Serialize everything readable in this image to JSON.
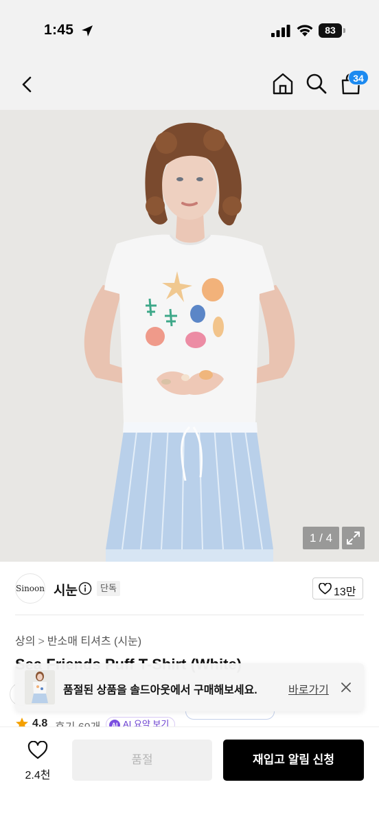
{
  "status_bar": {
    "time": "1:45",
    "battery": "83",
    "icons": [
      "location-arrow-icon",
      "signal-icon",
      "wifi-icon",
      "battery-icon"
    ]
  },
  "header": {
    "back_icon": "chevron-left-icon",
    "home_icon": "home-icon",
    "search_icon": "search-icon",
    "bag_icon": "shopping-bag-icon",
    "bag_count": "34",
    "badge_color": "#1c8af0"
  },
  "product_image": {
    "counter": "1 / 4",
    "expand_icon": "expand-icon"
  },
  "brand": {
    "logo_text": "Sinoon",
    "name": "시눈",
    "info_icon": "info-icon",
    "badge": "단독",
    "like_count": "13만"
  },
  "breadcrumb": {
    "items": [
      "상의",
      "반소매 티셔츠 (시눈)"
    ],
    "separator": ">"
  },
  "product": {
    "title_partial": "Sea Friends Puff T-Shirt (White)"
  },
  "rating": {
    "score": "4.8",
    "reviews": "후기 69개",
    "ai_label": "AI",
    "ai_text": "AI 요약 보기"
  },
  "toast": {
    "message": "품절된 상품을 솔드아웃에서 구매해보세요.",
    "link": "바로가기",
    "close_icon": "close-icon"
  },
  "bottom_bar": {
    "wish_count": "2.4천",
    "soldout_label": "품절",
    "restock_label": "재입고 알림 신청"
  }
}
